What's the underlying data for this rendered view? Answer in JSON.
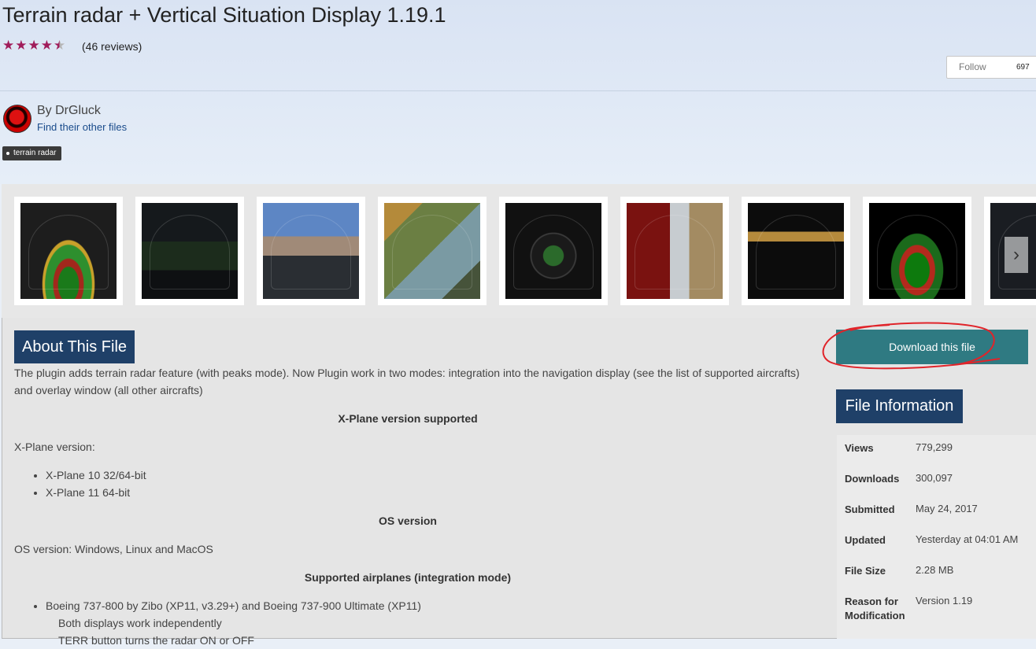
{
  "header": {
    "title": "Terrain radar + Vertical Situation Display 1.19.1",
    "rating": 4.5,
    "reviews": "(46 reviews)",
    "follow_label": "Follow",
    "follow_count": "697",
    "author": "By DrGluck",
    "author_link": "Find their other files",
    "tag": "terrain radar"
  },
  "gallery": {
    "thumbnails": [
      "radar",
      "cockpit",
      "sky",
      "map",
      "nd",
      "window",
      "pfd",
      "vsd",
      "dark"
    ],
    "next_icon": "chevron-right-icon"
  },
  "about": {
    "heading": "About This File",
    "intro": "The plugin adds terrain radar feature (with peaks mode). Now Plugin work in two modes: integration into the navigation display (see the list of supported aircrafts) and overlay window (all other aircrafts)",
    "xplane_heading": "X-Plane version supported",
    "xplane_label": "X-Plane version:",
    "xplane_versions": [
      "X-Plane 10 32/64-bit",
      "X-Plane 11 64-bit"
    ],
    "os_heading": "OS version",
    "os_text": "OS version: Windows, Linux and MacOS",
    "airplanes_heading": "Supported airplanes (integration mode)",
    "airplanes": [
      "Boeing 737-800 by Zibo (XP11, v3.29+) and Boeing 737-900 Ultimate (XP11)"
    ],
    "airplane_note_1": "Both displays work independently",
    "airplane_note_2": "TERR button turns the radar ON or OFF"
  },
  "sidebar": {
    "download_label": "Download this file",
    "annotation_color": "#e0242a",
    "info_heading": "File Information",
    "rows": [
      {
        "key": "Views",
        "value": "779,299"
      },
      {
        "key": "Downloads",
        "value": "300,097"
      },
      {
        "key": "Submitted",
        "value": "May 24, 2017"
      },
      {
        "key": "Updated",
        "value": "Yesterday at 04:01 AM"
      },
      {
        "key": "File Size",
        "value": "2.28 MB"
      },
      {
        "key": "Reason for Modification",
        "value": "Version 1.19"
      }
    ]
  }
}
